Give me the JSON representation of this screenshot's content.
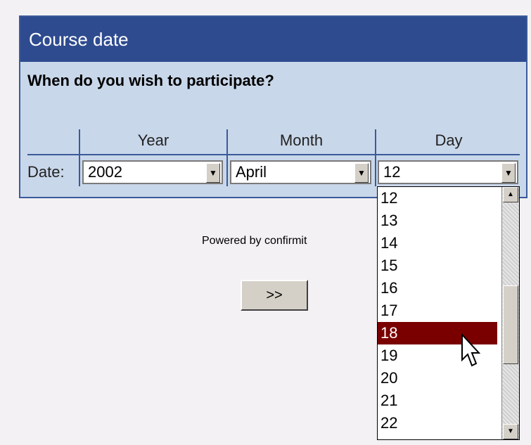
{
  "panel": {
    "title": "Course date",
    "question": "When do you wish to participate?",
    "columns": {
      "year": "Year",
      "month": "Month",
      "day": "Day"
    },
    "date_label": "Date:",
    "selects": {
      "year": "2002",
      "month": "April",
      "day": "12"
    }
  },
  "footer": {
    "powered_by": "Powered by confirmit",
    "next_label": ">>"
  },
  "day_dropdown": {
    "options": [
      "12",
      "13",
      "14",
      "15",
      "16",
      "17",
      "18",
      "19",
      "20",
      "21",
      "22"
    ],
    "highlighted": "18"
  },
  "colors": {
    "header": "#2e4b8f",
    "panel": "#c9d7ea",
    "highlight": "#7a0000"
  }
}
